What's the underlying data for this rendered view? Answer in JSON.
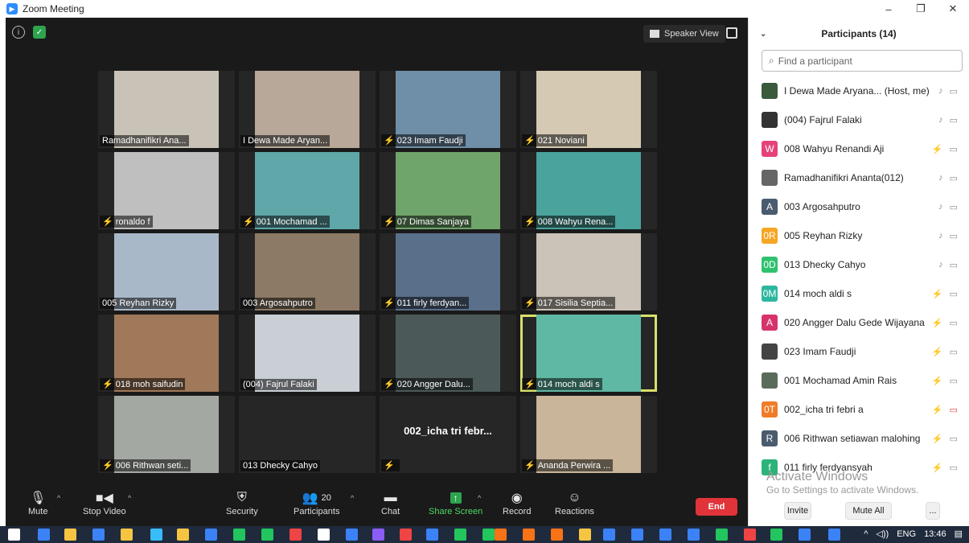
{
  "window": {
    "title": "Zoom Meeting",
    "min": "–",
    "max": "❐",
    "close": "✕"
  },
  "topbar": {
    "speaker_view": "Speaker View"
  },
  "tiles": [
    {
      "name": "Ramadhanifikri Ana...",
      "muted": false,
      "color": "#c9c2b6"
    },
    {
      "name": "I Dewa Made Aryan...",
      "muted": false,
      "color": "#b7a89a"
    },
    {
      "name": "023 Imam Faudji",
      "muted": true,
      "color": "#6f8fa8"
    },
    {
      "name": "021 Noviani",
      "muted": true,
      "color": "#d6c9b4"
    },
    {
      "name": "ronaldo f",
      "muted": true,
      "color": "#bfbfbf"
    },
    {
      "name": "001 Mochamad ...",
      "muted": true,
      "color": "#5fa7a8"
    },
    {
      "name": "07 Dimas Sanjaya",
      "muted": true,
      "color": "#6fa56a"
    },
    {
      "name": "008 Wahyu Rena...",
      "muted": true,
      "color": "#4aa39c"
    },
    {
      "name": "005 Reyhan Rizky",
      "muted": false,
      "color": "#a9b8c8"
    },
    {
      "name": "003 Argosahputro",
      "muted": false,
      "color": "#8c7a66"
    },
    {
      "name": "011 firly ferdyan...",
      "muted": true,
      "color": "#5a6f8a"
    },
    {
      "name": "017 Sisilia Septia...",
      "muted": true,
      "color": "#cbc3b7"
    },
    {
      "name": "018 moh saifudin",
      "muted": true,
      "color": "#a0785a"
    },
    {
      "name": "(004) Fajrul Falaki",
      "muted": false,
      "color": "#c9cfd4"
    },
    {
      "name": "020 Angger Dalu...",
      "muted": true,
      "color": "#4b5a58"
    },
    {
      "name": "014  moch aldi s",
      "muted": true,
      "color": "#5fb8a4",
      "active": true
    },
    {
      "name": "006 Rithwan seti...",
      "muted": true,
      "color": "#a4a8a2"
    },
    {
      "name": "013 Dhecky Cahyo",
      "muted": false,
      "color": "#262626",
      "novideo": true
    },
    {
      "name": "",
      "muted": true,
      "color": "#262626",
      "novideo": true,
      "big": "002_icha tri febr..."
    },
    {
      "name": "Ananda Perwira ...",
      "muted": true,
      "color": "#c8b59a"
    }
  ],
  "toolbar": {
    "mute": "Mute",
    "stop_video": "Stop Video",
    "security": "Security",
    "participants": "Participants",
    "participants_count": "20",
    "chat": "Chat",
    "share_screen": "Share Screen",
    "record": "Record",
    "reactions": "Reactions",
    "end": "End"
  },
  "panel": {
    "title": "Participants (14)",
    "search_placeholder": "Find a participant",
    "participants": [
      {
        "name": "I Dewa Made Aryana... (Host, me)",
        "avatar": "",
        "color": "#3b5a3c",
        "mic_muted": false,
        "cam_off": false
      },
      {
        "name": "(004) Fajrul Falaki",
        "avatar": "",
        "color": "#333333",
        "mic_muted": false,
        "cam_off": false
      },
      {
        "name": "008 Wahyu Renandi Aji",
        "avatar": "W",
        "color": "#e6427a",
        "mic_muted": true,
        "cam_off": false
      },
      {
        "name": "Ramadhanifikri Ananta(012)",
        "avatar": "",
        "color": "#666666",
        "mic_muted": false,
        "cam_off": false
      },
      {
        "name": "003 Argosahputro",
        "avatar": "A",
        "color": "#4a5b6e",
        "mic_muted": false,
        "cam_off": false
      },
      {
        "name": "005 Reyhan Rizky",
        "avatar": "0R",
        "color": "#f5a623",
        "mic_muted": false,
        "cam_off": false
      },
      {
        "name": "013 Dhecky Cahyo",
        "avatar": "0D",
        "color": "#2ec26e",
        "mic_muted": false,
        "cam_off": false
      },
      {
        "name": "014  moch aldi s",
        "avatar": "0M",
        "color": "#2db7a0",
        "mic_muted": true,
        "cam_off": false
      },
      {
        "name": "020 Angger Dalu Gede Wijayana",
        "avatar": "A",
        "color": "#d6336c",
        "mic_muted": true,
        "cam_off": false
      },
      {
        "name": "023 Imam Faudji",
        "avatar": "",
        "color": "#444444",
        "mic_muted": true,
        "cam_off": false
      },
      {
        "name": "001 Mochamad Amin Rais",
        "avatar": "",
        "color": "#5a6b5a",
        "mic_muted": true,
        "cam_off": false
      },
      {
        "name": "002_icha tri febri a",
        "avatar": "0T",
        "color": "#f07c2a",
        "mic_muted": true,
        "cam_off": true
      },
      {
        "name": "006 Rithwan setiawan malohing",
        "avatar": "R",
        "color": "#4a5b6e",
        "mic_muted": true,
        "cam_off": false
      },
      {
        "name": "011 firly ferdyansyah",
        "avatar": "f",
        "color": "#2db37a",
        "mic_muted": true,
        "cam_off": false
      }
    ],
    "activate_line1": "Activate Windows",
    "activate_line2": "Go to Settings to activate Windows.",
    "invite": "Invite",
    "mute_all": "Mute All",
    "more": "..."
  },
  "taskbar": {
    "lang": "ENG",
    "time": "13:46"
  }
}
